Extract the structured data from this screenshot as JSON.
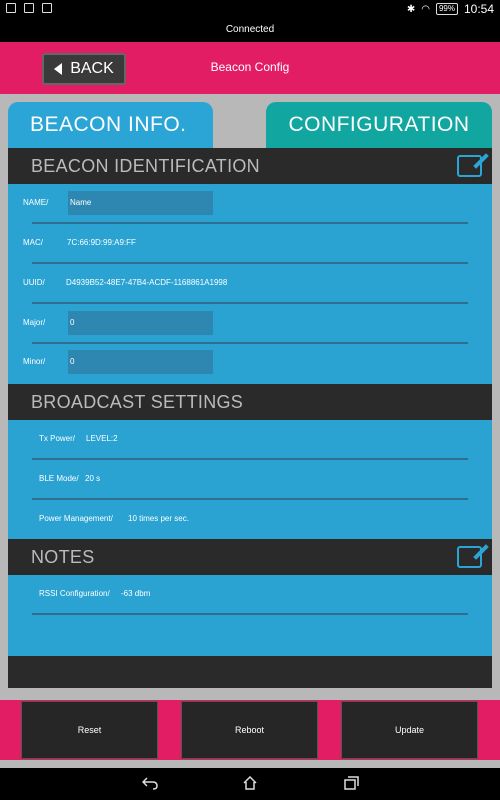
{
  "status": {
    "battery": "99%",
    "time": "10:54"
  },
  "connection": "Connected",
  "header": {
    "back_label": "BACK",
    "title": "Beacon Config"
  },
  "tabs": {
    "info": "BEACON INFO.",
    "config": "CONFIGURATION"
  },
  "identification": {
    "heading": "BEACON IDENTIFICATION",
    "name": {
      "label": "NAME/",
      "value": "Name"
    },
    "mac": {
      "label": "MAC/",
      "value": "7C:66:9D:99:A9:FF"
    },
    "uuid": {
      "label": "UUID/",
      "value": "D4939B52-48E7-47B4-ACDF-1168861A1998"
    },
    "major": {
      "label": "Major/",
      "value": "0"
    },
    "minor": {
      "label": "Minor/",
      "value": "0"
    }
  },
  "broadcast": {
    "heading": "BROADCAST SETTINGS",
    "tx_power": {
      "label": "Tx Power/",
      "value": "LEVEL:2"
    },
    "ble_mode": {
      "label": "BLE Mode/",
      "value": "20 s"
    },
    "power_mgmt": {
      "label": "Power Management/",
      "value": "10 times per sec."
    }
  },
  "notes": {
    "heading": "NOTES",
    "rssi": {
      "label": "RSSI Configuration/",
      "value": "-63 dbm"
    }
  },
  "footer": {
    "reset": "Reset",
    "reboot": "Reboot",
    "update": "Update"
  },
  "colors": {
    "accent": "#e31d63",
    "panel_blue": "#2aa3d3",
    "tab_teal": "#12a6a0",
    "section_dark": "#2a2a2a"
  }
}
